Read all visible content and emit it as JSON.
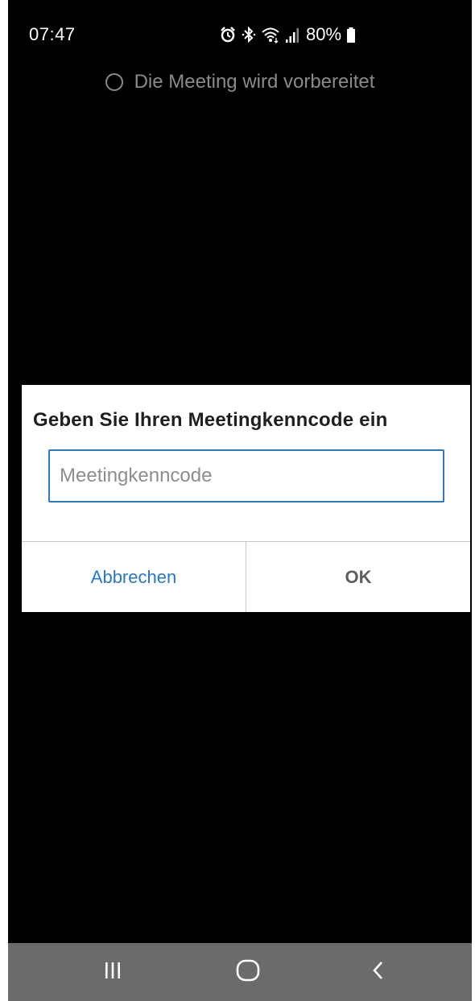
{
  "status_bar": {
    "time": "07:47",
    "battery_percent": "80%",
    "icons": [
      "alarm-icon",
      "bluetooth-icon",
      "wifi-icon",
      "signal-icon",
      "battery-icon"
    ]
  },
  "meeting": {
    "loading_text": "Die Meeting wird vorbereitet"
  },
  "dialog": {
    "title": "Geben Sie Ihren Meetingkenncode ein",
    "input_placeholder": "Meetingkenncode",
    "input_value": "",
    "cancel_label": "Abbrechen",
    "ok_label": "OK"
  },
  "nav_bar": {
    "icons": [
      "recent-apps-icon",
      "home-icon",
      "back-icon"
    ]
  },
  "colors": {
    "accent": "#2a78c4",
    "input_border": "#2f7bbd",
    "background": "#000000",
    "nav_bar": "#6b6b6b"
  }
}
